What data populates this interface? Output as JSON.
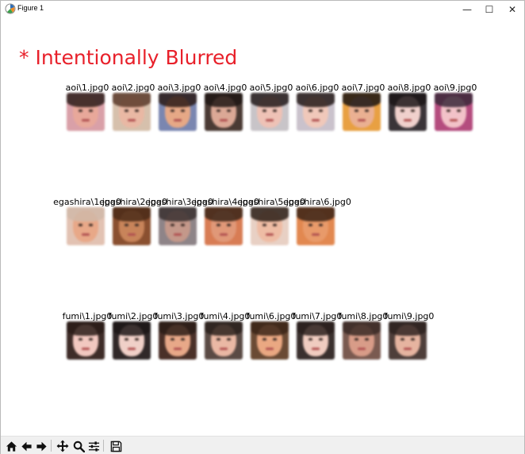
{
  "window": {
    "title": "Figure 1",
    "minimize_glyph": "—",
    "maximize_glyph": "☐",
    "close_glyph": "✕"
  },
  "overlay_text": "* Intentionally Blurred",
  "rows": [
    {
      "name": "aoi",
      "labels": [
        "aoi\\1.jpg0",
        "aoi\\2.jpg0",
        "aoi\\3.jpg0",
        "aoi\\4.jpg0",
        "aoi\\5.jpg0",
        "aoi\\6.jpg0",
        "aoi\\7.jpg0",
        "aoi\\8.jpg0",
        "aoi\\9.jpg0"
      ]
    },
    {
      "name": "egashira",
      "labels": [
        "egashira\\1.jpg0",
        "egashira\\2.jpg0",
        "egashira\\3.jpg0",
        "egashira\\4.jpg0",
        "egashira\\5.jpg0",
        "egashira\\6.jpg0"
      ]
    },
    {
      "name": "fumi",
      "labels": [
        "fumi\\1.jpg0",
        "fumi\\2.jpg0",
        "fumi\\3.jpg0",
        "fumi\\4.jpg0",
        "fumi\\6.jpg0",
        "fumi\\7.jpg0",
        "fumi\\8.jpg0",
        "fumi\\9.jpg0"
      ]
    }
  ],
  "toolbar": {
    "buttons": [
      "home-icon",
      "back-icon",
      "forward-icon",
      "pan-icon",
      "zoom-icon",
      "configure-subplots-icon",
      "save-icon"
    ]
  },
  "colors": {
    "overlay": "#e8202a",
    "toolbar_bg": "#f0f0f0"
  }
}
